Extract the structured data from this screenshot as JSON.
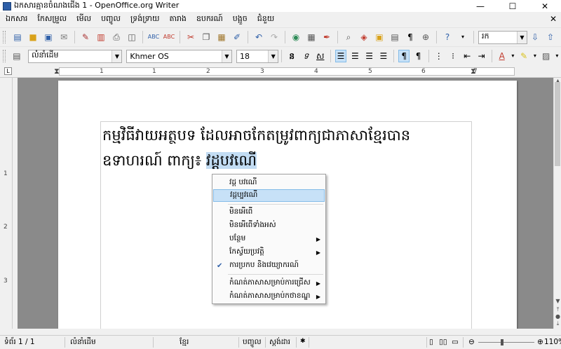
{
  "window": {
    "title": "ឯកសារគ្មានចំណងជើង 1 - OpenOffice.org Writer",
    "minimize": "—",
    "maximize": "☐",
    "close": "✕"
  },
  "menubar": {
    "items": [
      "ឯកសារ",
      "កែសម្រួល",
      "មើល",
      "បញ្ចូល",
      "ទ្រង់ទ្រាយ",
      "តារាង",
      "ឧបករណ៍",
      "បង្អួច",
      "ជំនួយ"
    ],
    "close_doc": "✕"
  },
  "toolbar2": {
    "style_value": "លំនាំដើម",
    "font_value": "Khmer OS",
    "size_value": "18"
  },
  "toolbar1": {
    "find_value": "រក"
  },
  "ruler": {
    "h_numbers": [
      "1",
      "1",
      "2",
      "3",
      "4",
      "5",
      "6",
      "7"
    ],
    "v_numbers": [
      "1",
      "2",
      "3"
    ]
  },
  "document": {
    "line1": "កម្មវិធីវាយអត្ថបទ ដែលអាចកែតម្រូវពាក្យជាភាសាខ្មែរបាន",
    "line2_prefix": "ឧទាហរណ៍ ពាក្យ៖ ",
    "line2_selected": "វដ្ដបវណើ"
  },
  "context_menu": {
    "items": [
      {
        "label": "វដ្ដ បវណើ"
      },
      {
        "label": "វដ្ដប្បវណើ"
      },
      {
        "label": "មិនអើពើ"
      },
      {
        "label": "មិនអើពើទាំងអស់"
      },
      {
        "label": "បន្ថែម"
      },
      {
        "label": "កែស្វ័យប្រវត្តិ"
      },
      {
        "label": "ការប្រកប និងវេយ្យាករណ៍"
      },
      {
        "label": "កំណត់ភាសាសម្រាប់ការជ្រើស"
      },
      {
        "label": "កំណត់ភាសាសម្រាប់កថាខណ្ឌ"
      }
    ],
    "highlight_color": "#c7e1f7"
  },
  "statusbar": {
    "page": "ទំព័រ 1 / 1",
    "style": "លំនាំដើម",
    "language": "ខ្មែរ",
    "insert_mode": "បញ្ចូល",
    "selection_mode": "ស្តង់ដារ",
    "zoom": "110%"
  },
  "colors": {
    "selection": "#c2dcf3",
    "doc_background": "#8a8a8a"
  }
}
